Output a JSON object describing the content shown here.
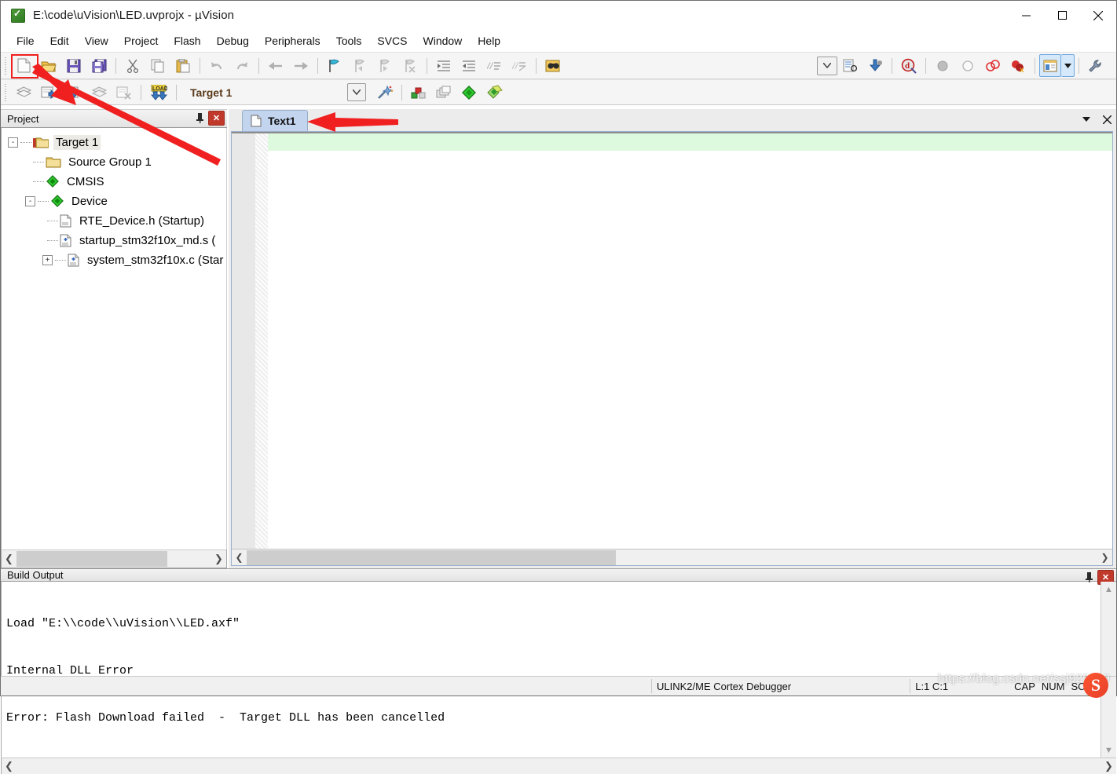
{
  "window": {
    "title": "E:\\code\\uVision\\LED.uvprojx - µVision",
    "app_icon": "uvision-logo-icon",
    "controls": {
      "minimize": "minimize-icon",
      "maximize": "maximize-icon",
      "close": "close-icon"
    }
  },
  "menubar": {
    "items": [
      {
        "label": "File"
      },
      {
        "label": "Edit"
      },
      {
        "label": "View"
      },
      {
        "label": "Project"
      },
      {
        "label": "Flash"
      },
      {
        "label": "Debug"
      },
      {
        "label": "Peripherals"
      },
      {
        "label": "Tools"
      },
      {
        "label": "SVCS"
      },
      {
        "label": "Window"
      },
      {
        "label": "Help"
      }
    ]
  },
  "toolbar_main": {
    "buttons": [
      {
        "name": "new-file-button",
        "icon": "new-file-icon",
        "highlighted": true
      },
      {
        "name": "open-file-button",
        "icon": "open-folder-icon"
      },
      {
        "name": "save-button",
        "icon": "save-disk-icon"
      },
      {
        "name": "save-all-button",
        "icon": "save-all-icon"
      },
      {
        "name": "cut-button",
        "icon": "scissors-icon"
      },
      {
        "name": "copy-button",
        "icon": "copy-icon"
      },
      {
        "name": "paste-button",
        "icon": "paste-icon"
      },
      {
        "name": "undo-button",
        "icon": "undo-arrow-icon"
      },
      {
        "name": "redo-button",
        "icon": "redo-arrow-icon"
      },
      {
        "name": "navigate-back-button",
        "icon": "arrow-left-icon"
      },
      {
        "name": "navigate-forward-button",
        "icon": "arrow-right-icon"
      },
      {
        "name": "toggle-bookmark-button",
        "icon": "bookmark-flag-icon"
      },
      {
        "name": "previous-bookmark-button",
        "icon": "bookmark-prev-icon"
      },
      {
        "name": "next-bookmark-button",
        "icon": "bookmark-next-icon"
      },
      {
        "name": "clear-bookmarks-button",
        "icon": "bookmark-clear-icon"
      },
      {
        "name": "indent-button",
        "icon": "indent-right-icon"
      },
      {
        "name": "outdent-button",
        "icon": "indent-left-icon"
      },
      {
        "name": "comment-button",
        "icon": "comment-lines-icon"
      },
      {
        "name": "uncomment-button",
        "icon": "uncomment-lines-icon"
      },
      {
        "name": "find-in-files-button",
        "icon": "binoculars-icon"
      }
    ],
    "right_buttons": [
      {
        "name": "configure-toolbar-button",
        "icon": "chevron-down-icon"
      },
      {
        "name": "open-source-browser-button",
        "icon": "source-browser-icon"
      },
      {
        "name": "debug-settings-button",
        "icon": "debug-download-icon"
      },
      {
        "name": "start-debug-button",
        "icon": "debug-magnifier-icon"
      },
      {
        "name": "insert-breakpoint-button",
        "icon": "breakpoint-filled-icon"
      },
      {
        "name": "kill-breakpoint-button",
        "icon": "breakpoint-empty-icon"
      },
      {
        "name": "disable-breakpoint-button",
        "icon": "breakpoint-disable-icon"
      },
      {
        "name": "kill-all-breakpoints-button",
        "icon": "breakpoint-kill-all-icon"
      },
      {
        "name": "manage-windows-button",
        "icon": "window-panel-icon",
        "selected": true
      },
      {
        "name": "window-dropdown-button",
        "icon": "caret-down-icon"
      },
      {
        "name": "configure-button",
        "icon": "wrench-icon"
      }
    ]
  },
  "toolbar_build": {
    "buttons": [
      {
        "name": "translate-button",
        "icon": "translate-file-icon"
      },
      {
        "name": "build-button",
        "icon": "build-target-icon"
      },
      {
        "name": "rebuild-button",
        "icon": "rebuild-all-icon"
      },
      {
        "name": "batch-build-button",
        "icon": "batch-build-icon"
      },
      {
        "name": "stop-build-button",
        "icon": "stop-build-icon"
      },
      {
        "name": "download-button",
        "icon": "load-download-icon"
      }
    ],
    "target_label": "Target 1",
    "combo_arrow_icon": "chevron-down-icon",
    "right_buttons": [
      {
        "name": "target-options-button",
        "icon": "magic-wand-icon"
      },
      {
        "name": "manage-project-items-button",
        "icon": "project-items-icon"
      },
      {
        "name": "multi-project-button",
        "icon": "multi-project-icon"
      },
      {
        "name": "manage-run-time-button",
        "icon": "green-diamond-icon"
      },
      {
        "name": "pack-installer-button",
        "icon": "pack-installer-icon"
      }
    ]
  },
  "project_panel": {
    "title": "Project",
    "pin_icon": "pin-icon",
    "close_icon": "close-icon",
    "tree": [
      {
        "label": "Target 1",
        "icon": "target-folder-icon",
        "level": 0,
        "expander": "-",
        "selected": true
      },
      {
        "label": "Source Group 1",
        "icon": "folder-icon",
        "level": 1,
        "expander": ""
      },
      {
        "label": "CMSIS",
        "icon": "green-diamond-icon",
        "level": 1,
        "expander": ""
      },
      {
        "label": "Device",
        "icon": "green-diamond-icon",
        "level": 1,
        "expander": "-"
      },
      {
        "label": "RTE_Device.h (Startup)",
        "icon": "header-file-icon",
        "level": 2,
        "expander": ""
      },
      {
        "label": "startup_stm32f10x_md.s (",
        "icon": "source-file-icon",
        "level": 2,
        "expander": ""
      },
      {
        "label": "system_stm32f10x.c (Star",
        "icon": "source-file-icon",
        "level": 2,
        "expander": "+"
      }
    ],
    "scroll_left_icon": "chevron-left-icon",
    "scroll_right_icon": "chevron-right-icon"
  },
  "editor": {
    "tabs": [
      {
        "label": "Text1",
        "icon": "text-file-icon",
        "active": true
      }
    ],
    "dropdown_icon": "caret-down-icon",
    "close_icon": "close-icon",
    "content": "",
    "scroll_left_icon": "chevron-left-icon",
    "scroll_right_icon": "chevron-right-icon"
  },
  "build_output": {
    "title": "Build Output",
    "pin_icon": "pin-icon",
    "close_icon": "close-icon",
    "lines": [
      "Load \"E:\\\\code\\\\uVision\\\\LED.axf\"",
      "Internal DLL Error",
      "Error: Flash Download failed  -  Target DLL has been cancelled"
    ],
    "scroll_up_icon": "chevron-up-icon",
    "scroll_down_icon": "chevron-down-icon",
    "scroll_left_icon": "chevron-left-icon",
    "scroll_right_icon": "chevron-right-icon"
  },
  "status_bar": {
    "debugger": "ULINK2/ME Cortex Debugger",
    "position": "L:1 C:1",
    "flags": [
      "CAP",
      "NUM",
      "SCRL"
    ]
  },
  "annotations": {
    "arrow_to_new_file": "red-arrow-pointing-new-file-button",
    "arrow_to_tab": "red-arrow-pointing-text1-tab",
    "highlight_box": "red-highlight-box-new-file-button",
    "accent_color": "#f02020"
  },
  "watermark": {
    "text": "https://blog.csdn.net/ssj925319",
    "logo": "csdn-logo-icon"
  }
}
